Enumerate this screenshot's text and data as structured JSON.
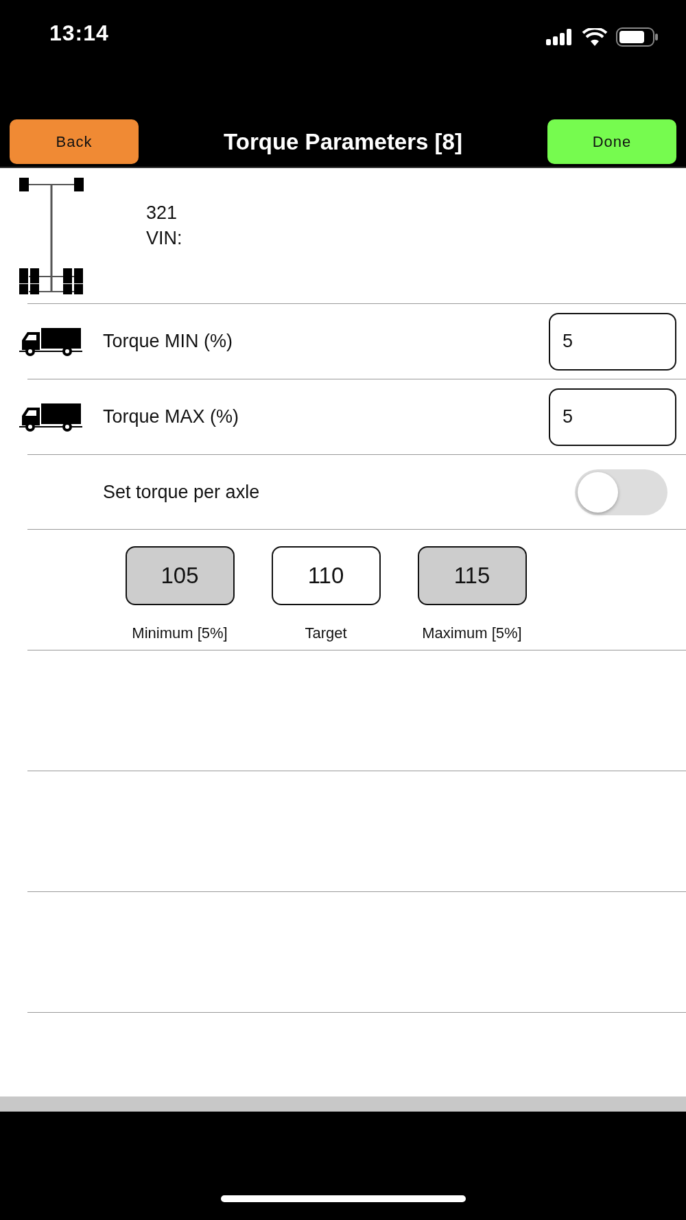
{
  "status_bar": {
    "time": "13:14"
  },
  "nav": {
    "back": "Back",
    "title": "Torque Parameters [8]",
    "done": "Done"
  },
  "vehicle": {
    "number": "321",
    "vin": "VIN:"
  },
  "settings": [
    {
      "kind": "field",
      "label": "Torque MIN (%)",
      "value": "5"
    },
    {
      "kind": "field",
      "label": "Torque MAX (%)",
      "value": "5"
    },
    {
      "kind": "toggle",
      "label": "Set torque per axle",
      "on": false
    }
  ],
  "values": [
    {
      "value": "105",
      "label": "Minimum [5%]",
      "disabled": true
    },
    {
      "value": "110",
      "label": "Target",
      "disabled": false
    },
    {
      "value": "115",
      "label": "Maximum [5%]",
      "disabled": true
    }
  ]
}
